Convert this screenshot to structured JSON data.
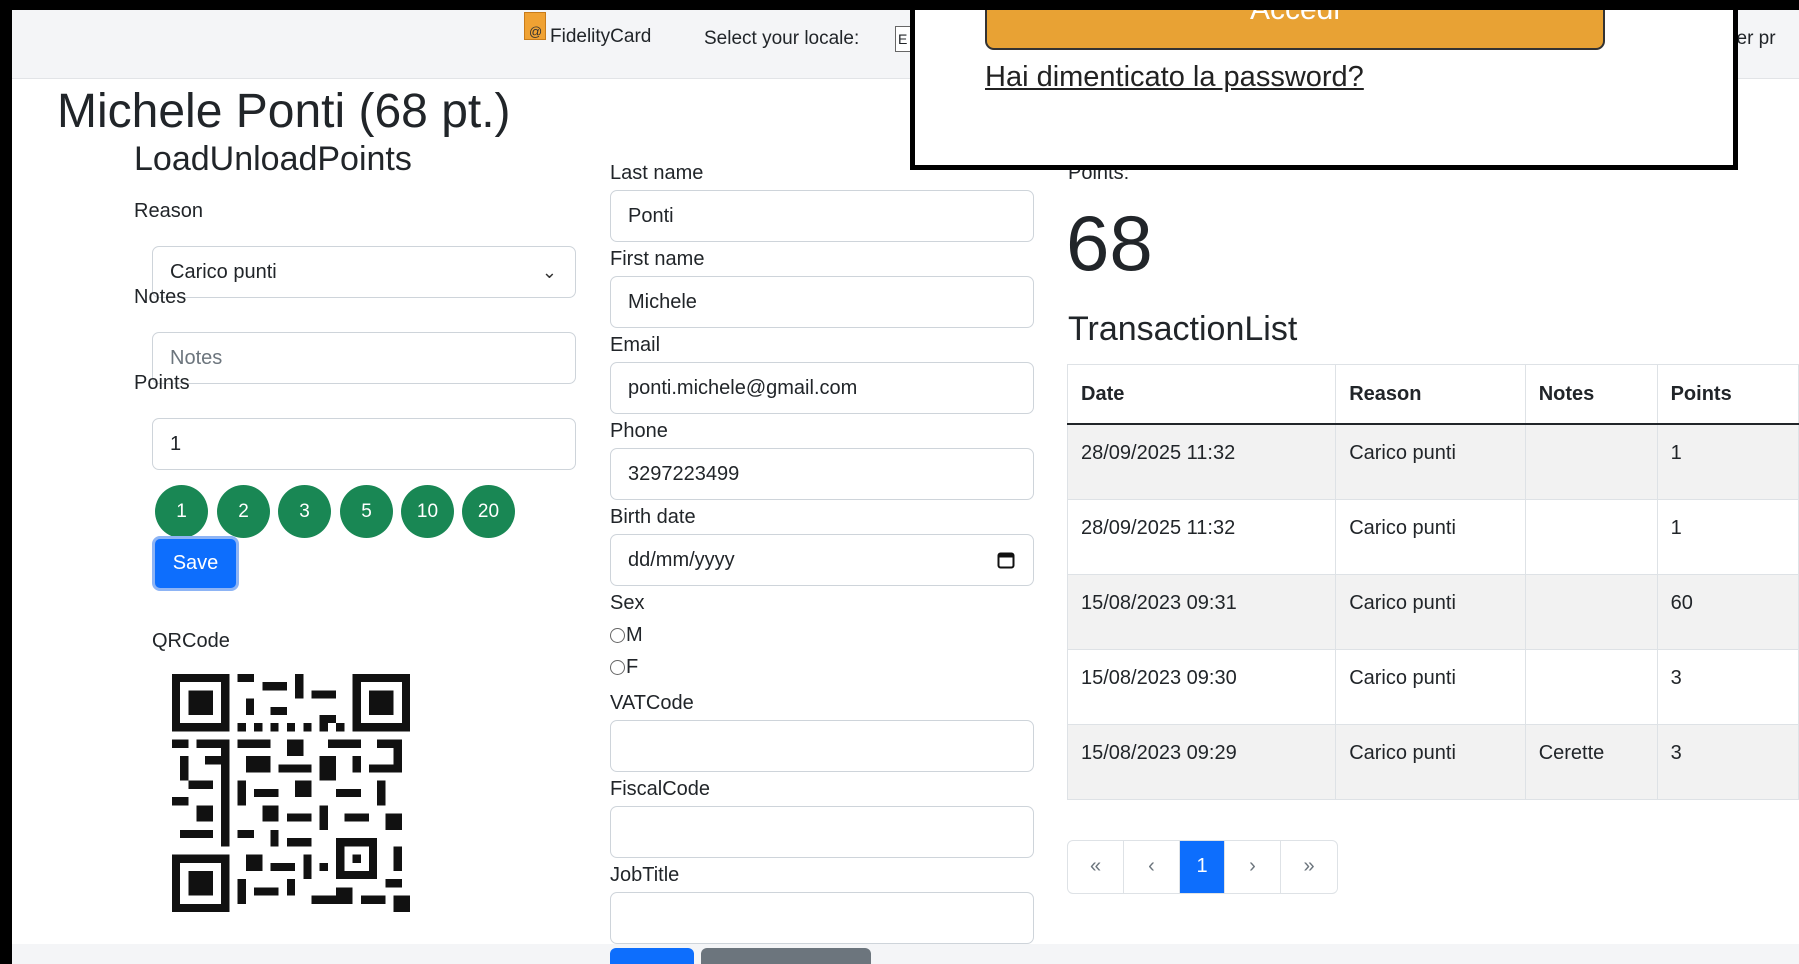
{
  "navbar": {
    "brand_logo_text": "@",
    "brand": "FidelityCard",
    "locale_label": "Select your locale:",
    "locale_value": "E",
    "user_profile": "ser pr"
  },
  "login": {
    "submit_label": "Accedi",
    "forgot_password": "Hai dimenticato la password?"
  },
  "page": {
    "title": "Michele Ponti (68 pt.)"
  },
  "load_unload": {
    "heading": "LoadUnloadPoints",
    "reason_label": "Reason",
    "reason_value": "Carico punti",
    "notes_label": "Notes",
    "notes_placeholder": "Notes",
    "points_label": "Points",
    "points_value": "1",
    "quick_values": [
      "1",
      "2",
      "3",
      "5",
      "10",
      "20"
    ],
    "save_label": "Save",
    "qrcode_label": "QRCode"
  },
  "customer": {
    "last_name_label": "Last name",
    "last_name": "Ponti",
    "first_name_label": "First name",
    "first_name": "Michele",
    "email_label": "Email",
    "email": "ponti.michele@gmail.com",
    "phone_label": "Phone",
    "phone": "3297223499",
    "birth_date_label": "Birth date",
    "birth_date_placeholder": "dd/mm/yyyy",
    "sex_label": "Sex",
    "sex_options": [
      "M",
      "F"
    ],
    "vat_label": "VATCode",
    "fiscal_label": "FiscalCode",
    "job_label": "JobTitle"
  },
  "summary": {
    "points_label": "Points:",
    "points_value": "68",
    "transactions_heading": "TransactionList",
    "columns": [
      "Date",
      "Reason",
      "Notes",
      "Points"
    ],
    "rows": [
      {
        "date": "28/09/2025 11:32",
        "reason": "Carico punti",
        "notes": "",
        "points": "1"
      },
      {
        "date": "28/09/2025 11:32",
        "reason": "Carico punti",
        "notes": "",
        "points": "1"
      },
      {
        "date": "15/08/2023 09:31",
        "reason": "Carico punti",
        "notes": "",
        "points": "60"
      },
      {
        "date": "15/08/2023 09:30",
        "reason": "Carico punti",
        "notes": "",
        "points": "3"
      },
      {
        "date": "15/08/2023 09:29",
        "reason": "Carico punti",
        "notes": "Cerette",
        "points": "3"
      }
    ],
    "pagination": {
      "first": "«",
      "prev": "‹",
      "current": "1",
      "next": "›",
      "last": "»"
    }
  },
  "colors": {
    "primary": "#0d6efd",
    "success": "#198754",
    "login_button": "#e8a234"
  }
}
